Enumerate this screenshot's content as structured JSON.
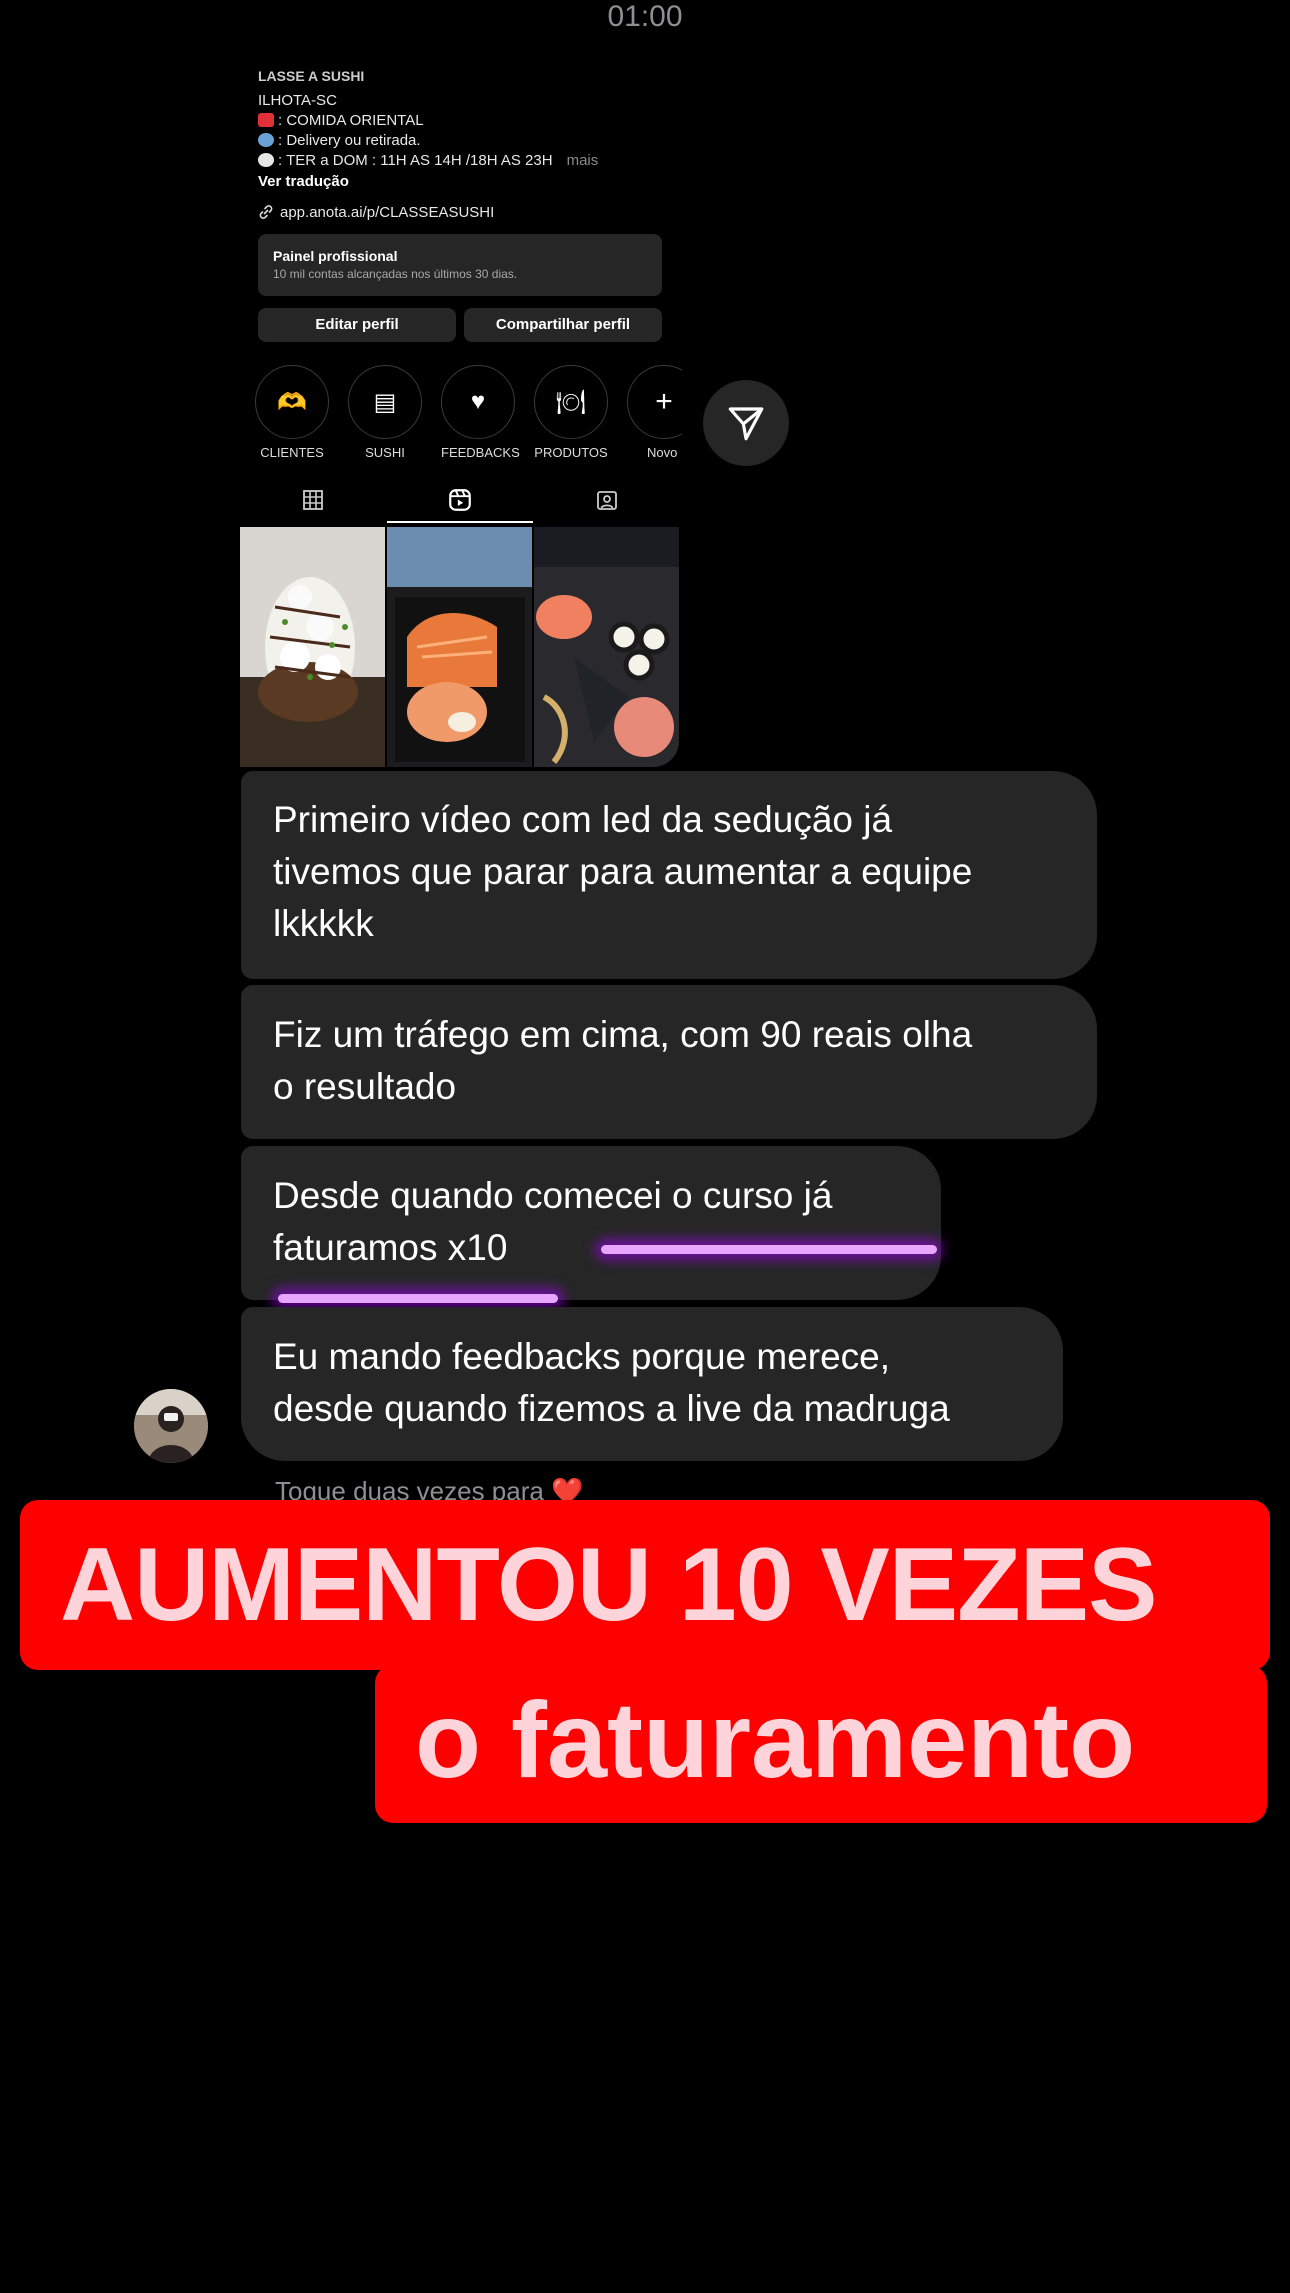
{
  "status_bar": {
    "time": "01:00"
  },
  "profile": {
    "name_partial": "LASSE A SUSHI",
    "location": "ILHOTA-SC",
    "bio_lines": [
      {
        "emoji_color": "#e0303a",
        "text": ": COMIDA ORIENTAL"
      },
      {
        "emoji_color": "#6aa3d6",
        "text": ": Delivery ou retirada."
      },
      {
        "emoji_color": "#e6e6e6",
        "text": ": TER a DOM : 11H AS 14H /18H AS 23H"
      }
    ],
    "more_label": "mais",
    "translate_label": "Ver tradução",
    "link": "app.anota.ai/p/CLASSEASUSHI",
    "panel": {
      "title": "Painel profissional",
      "subtitle": "10 mil contas alcançadas nos últimos 30 dias."
    },
    "edit_button": "Editar perfil",
    "share_button": "Compartilhar perfil",
    "highlights": [
      {
        "icon": "hands-heart-icon",
        "glyph": "🫶",
        "label": "CLIENTES"
      },
      {
        "icon": "menu-icon",
        "glyph": "▤",
        "label": "SUSHI"
      },
      {
        "icon": "heart-icon",
        "glyph": "♥",
        "label": "FEEDBACKS"
      },
      {
        "icon": "dish-icon",
        "glyph": "🍽",
        "label": "PRODUTOS"
      },
      {
        "icon": "plus-icon",
        "glyph": "+",
        "label": "Novo"
      }
    ],
    "tabs": [
      {
        "icon": "grid-icon",
        "active": false
      },
      {
        "icon": "reels-icon",
        "active": true
      },
      {
        "icon": "tagged-icon",
        "active": false
      }
    ],
    "thumbnails": [
      {
        "subject": "sushi-rolls-photo"
      },
      {
        "subject": "salmon-box-photo"
      },
      {
        "subject": "sushi-platter-photo"
      }
    ]
  },
  "messages": [
    {
      "lines": [
        "Primeiro vídeo com led da sedução já",
        "tivemos que parar para aumentar a equipe",
        "lkkkkk"
      ]
    },
    {
      "lines": [
        "Fiz um tráfego em cima, com 90 reais olha",
        "o resultado"
      ]
    },
    {
      "lines": [
        "Desde quando comecei o curso já",
        "faturamos x10"
      ]
    },
    {
      "lines": [
        "Eu mando feedbacks porque merece,",
        "desde quando fizemos a live da madruga"
      ]
    }
  ],
  "reaction_hint": "Toque duas vezes para",
  "reaction_emoji": "❤️",
  "banner": {
    "line1": "AUMENTOU 10 VEZES",
    "line2": "o faturamento"
  },
  "colors": {
    "background": "#000000",
    "bubble": "#262626",
    "banner_red": "#ff0000",
    "banner_text": "#ffd3da",
    "highlight_glow": "#aa00ff"
  }
}
